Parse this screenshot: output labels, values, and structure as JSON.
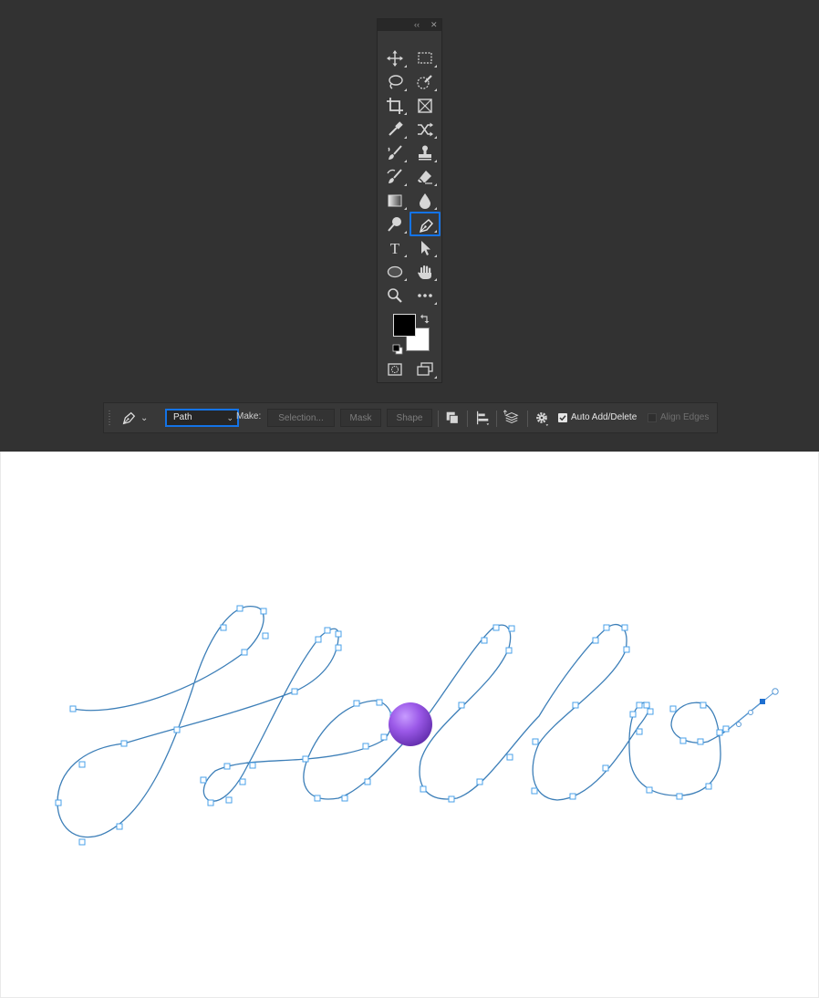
{
  "toolbox": {
    "collapse_icon": "double-chevron-left-icon",
    "close_icon": "close-icon",
    "tools": [
      {
        "name": "move-tool",
        "icon": "move-icon"
      },
      {
        "name": "rectangular-marquee-tool",
        "icon": "marquee-icon"
      },
      {
        "name": "lasso-tool",
        "icon": "lasso-icon"
      },
      {
        "name": "quick-selection-tool",
        "icon": "quick-selection-icon"
      },
      {
        "name": "crop-tool",
        "icon": "crop-icon"
      },
      {
        "name": "frame-tool",
        "icon": "frame-icon"
      },
      {
        "name": "eyedropper-tool",
        "icon": "eyedropper-icon"
      },
      {
        "name": "content-aware-move-tool",
        "icon": "shuffle-icon"
      },
      {
        "name": "brush-tool",
        "icon": "brush-icon"
      },
      {
        "name": "clone-stamp-tool",
        "icon": "stamp-icon"
      },
      {
        "name": "history-brush-tool",
        "icon": "history-brush-icon"
      },
      {
        "name": "eraser-tool",
        "icon": "eraser-icon"
      },
      {
        "name": "gradient-tool",
        "icon": "gradient-icon"
      },
      {
        "name": "blur-tool",
        "icon": "drop-icon"
      },
      {
        "name": "dodge-tool",
        "icon": "dodge-icon"
      },
      {
        "name": "pen-tool",
        "icon": "pen-icon",
        "selected": true
      },
      {
        "name": "type-tool",
        "icon": "type-icon",
        "label": "T"
      },
      {
        "name": "path-selection-tool",
        "icon": "arrow-icon"
      },
      {
        "name": "ellipse-tool",
        "icon": "ellipse-icon"
      },
      {
        "name": "hand-tool",
        "icon": "hand-icon"
      },
      {
        "name": "zoom-tool",
        "icon": "magnifier-icon"
      },
      {
        "name": "edit-toolbar",
        "icon": "more-icon"
      }
    ],
    "foreground_color": "#000000",
    "background_color": "#ffffff",
    "quick_mask_icon": "quick-mask-icon",
    "screen_mode_icon": "screen-mode-icon"
  },
  "options_bar": {
    "tool_preset_icon": "pen-icon",
    "mode_select": "Path",
    "make_label": "Make:",
    "make_buttons": [
      "Selection...",
      "Mask",
      "Shape"
    ],
    "auto_add_delete": {
      "label": "Auto Add/Delete",
      "checked": true
    },
    "align_edges": {
      "label": "Align Edges",
      "checked": false
    }
  },
  "canvas": {
    "path_color": "#3d7fb8",
    "anchor_color": "#4aa0e8",
    "ball_color": "#9b59e8"
  }
}
